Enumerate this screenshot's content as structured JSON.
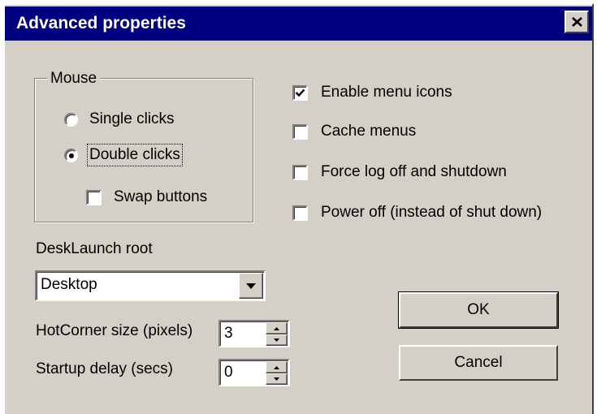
{
  "window": {
    "title": "Advanced properties",
    "close_glyph": "close-icon"
  },
  "mouse_group": {
    "legend": "Mouse",
    "single_clicks": {
      "label": "Single clicks",
      "selected": false
    },
    "double_clicks": {
      "label": "Double clicks",
      "selected": true
    },
    "swap_buttons": {
      "label": "Swap buttons",
      "checked": false
    }
  },
  "options": {
    "enable_menu_icons": {
      "label": "Enable menu icons",
      "checked": true
    },
    "cache_menus": {
      "label": "Cache menus",
      "checked": false
    },
    "force_logoff": {
      "label": "Force log off and shutdown",
      "checked": false
    },
    "power_off": {
      "label": "Power off (instead of shut down)",
      "checked": false
    }
  },
  "desklaunch_root": {
    "label": "DeskLaunch root",
    "value": "Desktop"
  },
  "hotcorner": {
    "label": "HotCorner size (pixels)",
    "value": "3"
  },
  "startup_delay": {
    "label": "Startup delay (secs)",
    "value": "0"
  },
  "buttons": {
    "ok": "OK",
    "cancel": "Cancel"
  },
  "colors": {
    "titlebar": "#000080",
    "face": "#d4d0c8"
  }
}
